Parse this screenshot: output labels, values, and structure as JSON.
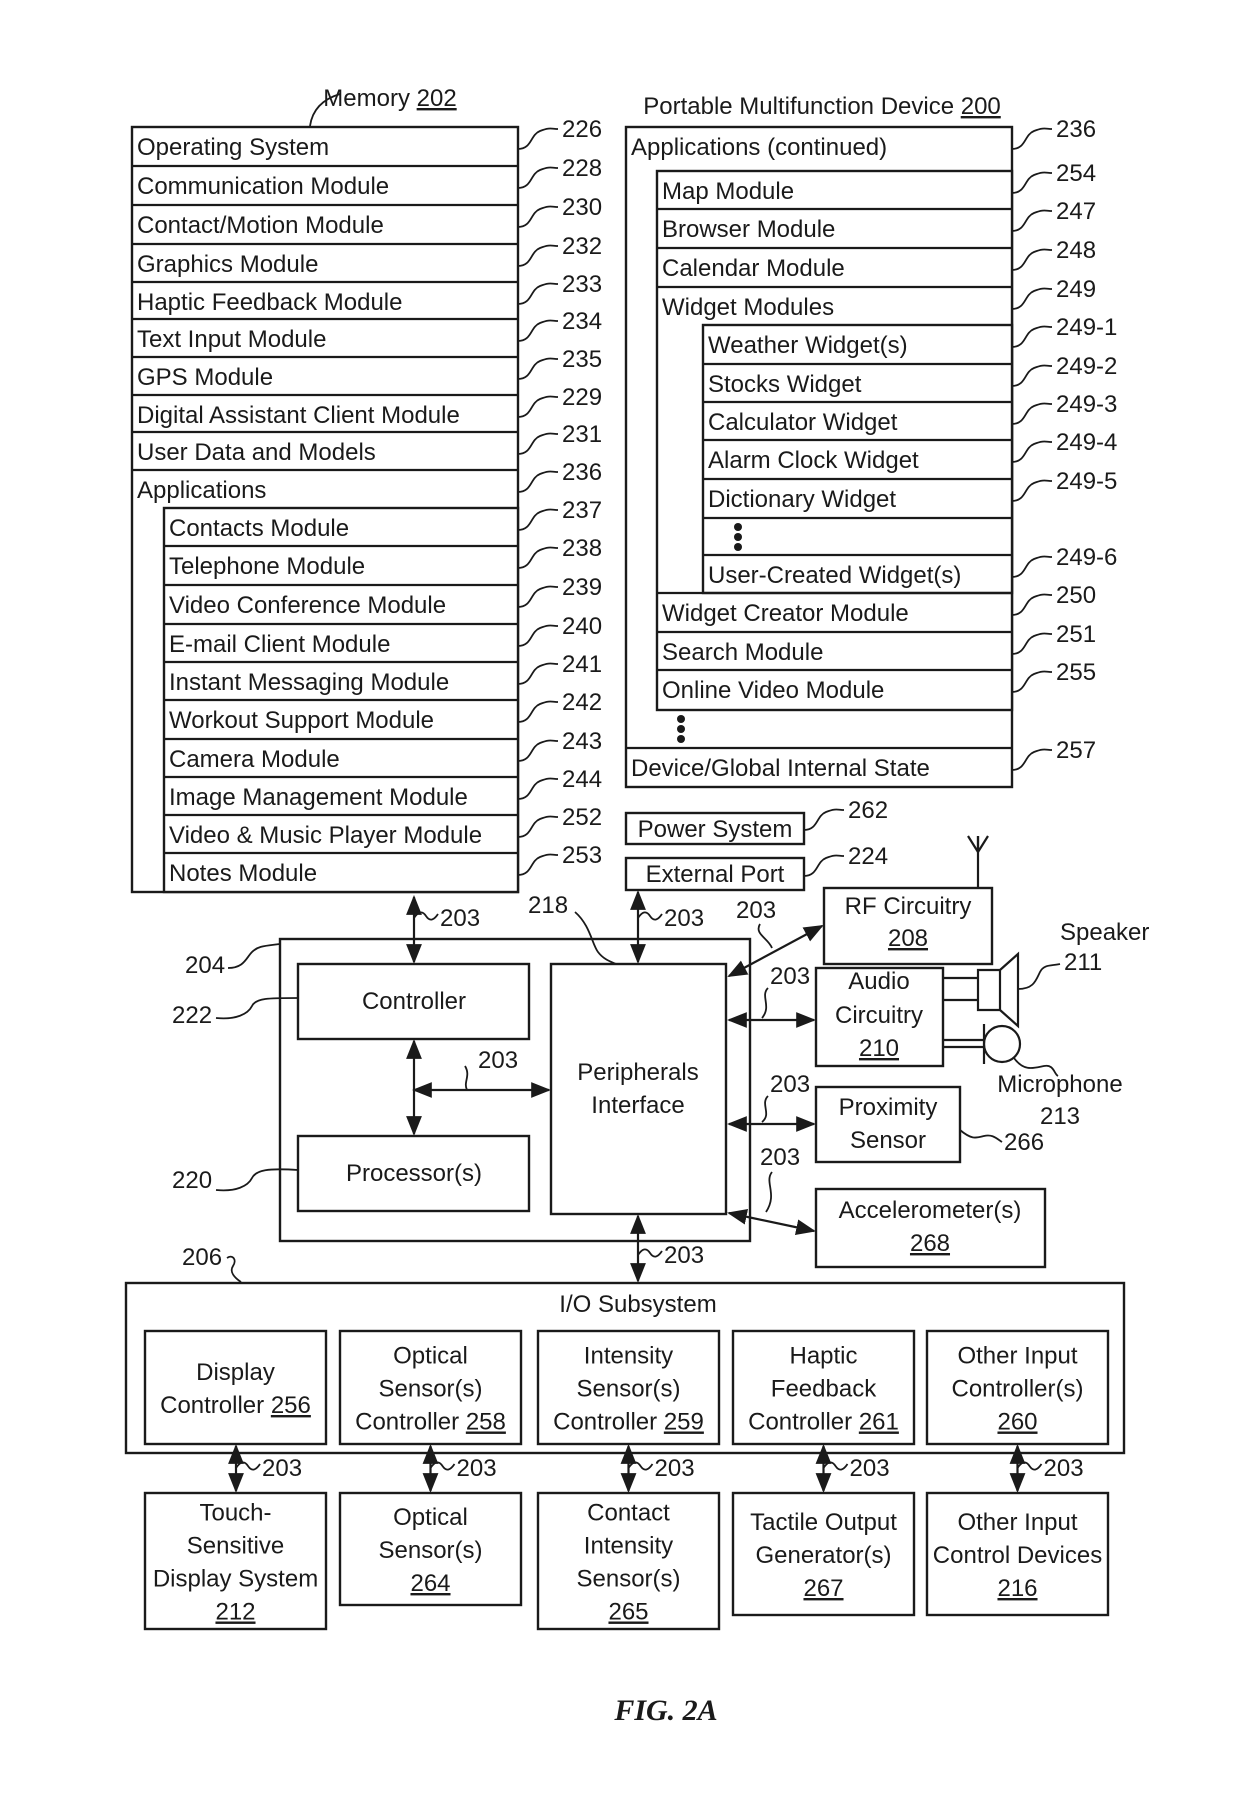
{
  "figure_label": "FIG. 2A",
  "memory": {
    "title": "Memory",
    "ref": "202",
    "rows": [
      {
        "label": "Operating System",
        "ref": "226"
      },
      {
        "label": "Communication Module",
        "ref": "228"
      },
      {
        "label": "Contact/Motion Module",
        "ref": "230"
      },
      {
        "label": "Graphics Module",
        "ref": "232"
      },
      {
        "label": "Haptic Feedback Module",
        "ref": "233"
      },
      {
        "label": "Text Input Module",
        "ref": "234"
      },
      {
        "label": "GPS Module",
        "ref": "235"
      },
      {
        "label": "Digital Assistant Client Module",
        "ref": "229"
      },
      {
        "label": "User Data and Models",
        "ref": "231"
      },
      {
        "label": "Applications",
        "ref": "236"
      }
    ],
    "applications": [
      {
        "label": "Contacts Module",
        "ref": "237"
      },
      {
        "label": "Telephone Module",
        "ref": "238"
      },
      {
        "label": "Video Conference Module",
        "ref": "239"
      },
      {
        "label": "E-mail Client Module",
        "ref": "240"
      },
      {
        "label": "Instant Messaging Module",
        "ref": "241"
      },
      {
        "label": "Workout Support Module",
        "ref": "242"
      },
      {
        "label": "Camera Module",
        "ref": "243"
      },
      {
        "label": "Image Management Module",
        "ref": "244"
      },
      {
        "label": "Video & Music Player Module",
        "ref": "252"
      },
      {
        "label": "Notes Module",
        "ref": "253"
      }
    ]
  },
  "device": {
    "title": "Portable Multifunction Device",
    "ref": "200",
    "applications_continued": {
      "label": "Applications (continued)",
      "ref": "236"
    },
    "modules": [
      {
        "label": "Map Module",
        "ref": "254"
      },
      {
        "label": "Browser Module",
        "ref": "247"
      },
      {
        "label": "Calendar Module",
        "ref": "248"
      },
      {
        "label": "Widget Modules",
        "ref": "249"
      }
    ],
    "widgets": [
      {
        "label": "Weather Widget(s)",
        "ref": "249-1"
      },
      {
        "label": "Stocks Widget",
        "ref": "249-2"
      },
      {
        "label": "Calculator Widget",
        "ref": "249-3"
      },
      {
        "label": "Alarm Clock Widget",
        "ref": "249-4"
      },
      {
        "label": "Dictionary Widget",
        "ref": "249-5"
      },
      {
        "label": "⋮",
        "ref": ""
      },
      {
        "label": "User-Created Widget(s)",
        "ref": "249-6"
      }
    ],
    "more_modules": [
      {
        "label": "Widget Creator Module",
        "ref": "250"
      },
      {
        "label": "Search Module",
        "ref": "251"
      },
      {
        "label": "Online Video Module",
        "ref": "255"
      }
    ],
    "internal_state": {
      "label": "Device/Global Internal State",
      "ref": "257"
    }
  },
  "power_system": {
    "label": "Power System",
    "ref": "262"
  },
  "external_port": {
    "label": "External Port",
    "ref": "224"
  },
  "chip": {
    "ref": "204",
    "controller": {
      "label": "Controller",
      "ref": "222"
    },
    "processor": {
      "label": "Processor(s)",
      "ref": "220"
    },
    "peripherals": {
      "label_lines": [
        "Peripherals",
        "Interface"
      ],
      "ref": "218"
    }
  },
  "bus_ref": "203",
  "peripherals": {
    "rf": {
      "label": "RF Circuitry",
      "ref": "208"
    },
    "audio": {
      "label_lines": [
        "Audio",
        "Circuitry"
      ],
      "ref": "210"
    },
    "speaker": {
      "label": "Speaker",
      "ref": "211"
    },
    "microphone": {
      "label": "Microphone",
      "ref": "213"
    },
    "proximity": {
      "label_lines": [
        "Proximity",
        "Sensor"
      ],
      "ref": "266"
    },
    "accelerometer": {
      "label": "Accelerometer(s)",
      "ref": "268"
    }
  },
  "io_subsystem": {
    "title": "I/O Subsystem",
    "ref": "206",
    "controllers": [
      {
        "label_lines": [
          "Display",
          "Controller"
        ],
        "ref": "256",
        "ref_inline": true
      },
      {
        "label_lines": [
          "Optical",
          "Sensor(s)",
          "Controller"
        ],
        "ref": "258",
        "ref_inline": true
      },
      {
        "label_lines": [
          "Intensity",
          "Sensor(s)",
          "Controller"
        ],
        "ref": "259",
        "ref_inline": true
      },
      {
        "label_lines": [
          "Haptic",
          "Feedback",
          "Controller"
        ],
        "ref": "261",
        "ref_inline": true
      },
      {
        "label_lines": [
          "Other Input",
          "Controller(s)"
        ],
        "ref": "260",
        "ref_inline": false
      }
    ],
    "devices": [
      {
        "label_lines": [
          "Touch-",
          "Sensitive",
          "Display System"
        ],
        "ref": "212"
      },
      {
        "label_lines": [
          "Optical",
          "Sensor(s)"
        ],
        "ref": "264"
      },
      {
        "label_lines": [
          "Contact",
          "Intensity",
          "Sensor(s)"
        ],
        "ref": "265"
      },
      {
        "label_lines": [
          "Tactile Output",
          "Generator(s)"
        ],
        "ref": "267"
      },
      {
        "label_lines": [
          "Other Input",
          "Control Devices"
        ],
        "ref": "216"
      }
    ]
  }
}
